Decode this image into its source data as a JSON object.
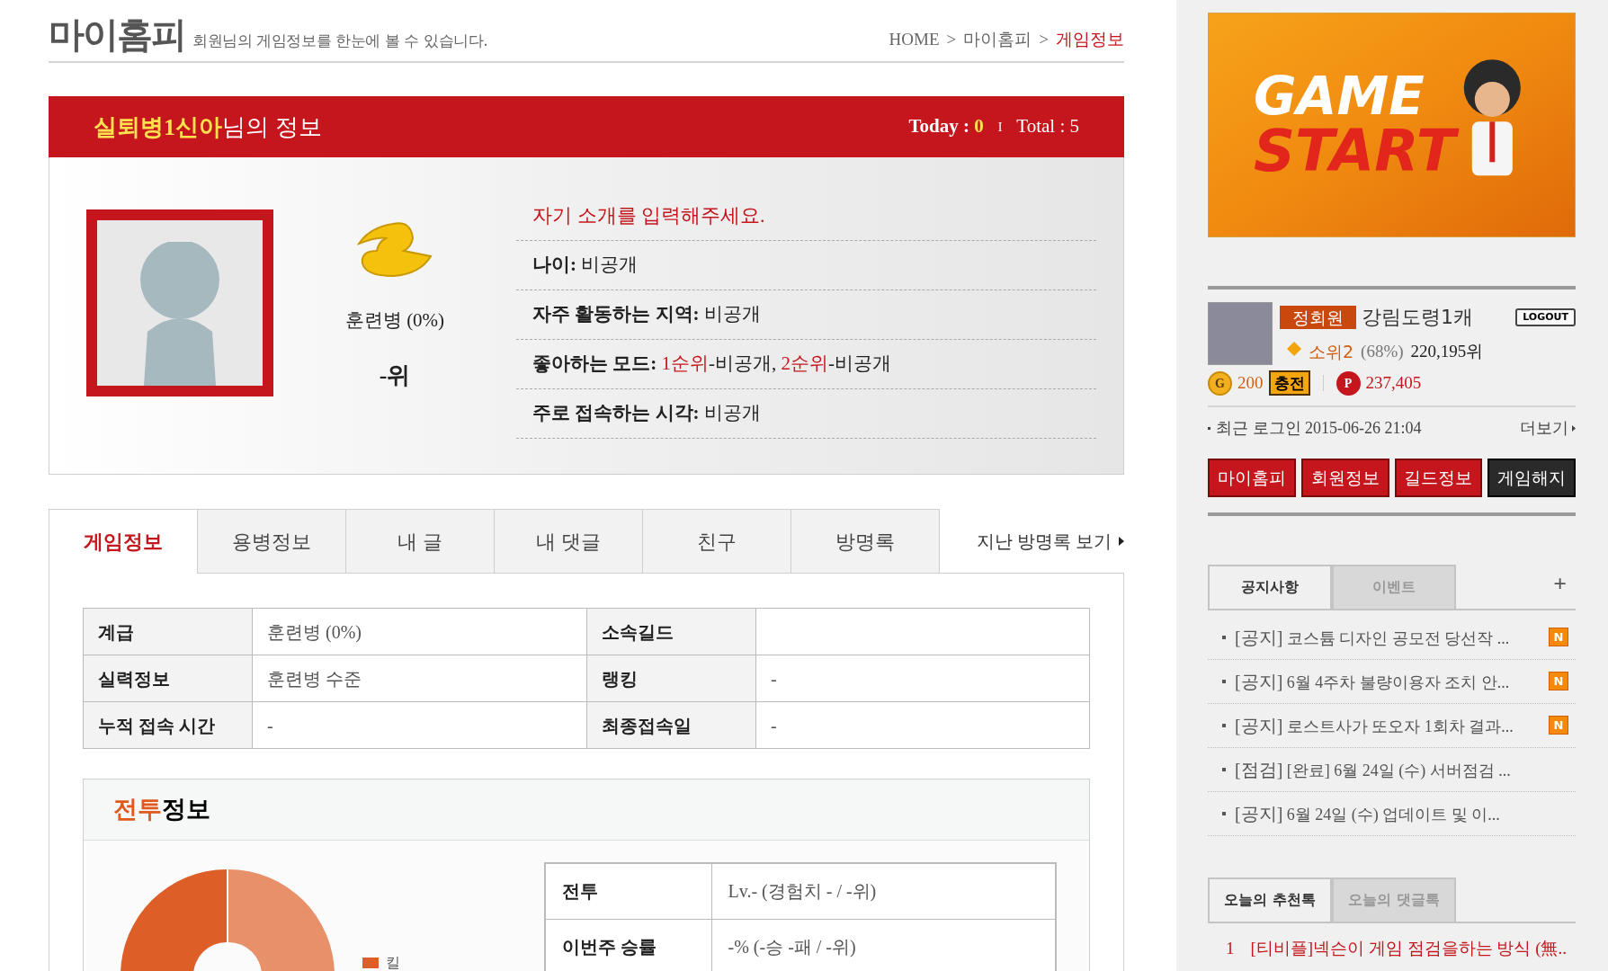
{
  "header": {
    "logo": "마이홈피",
    "subtitle": "회원님의 게임정보를 한눈에 볼 수 있습니다.",
    "breadcrumb": [
      {
        "label": "HOME",
        "selected": false
      },
      {
        "label": "마이홈피",
        "selected": false
      },
      {
        "label": "게임정보",
        "selected": true
      }
    ],
    "separator": ">"
  },
  "profile": {
    "name": "실퇴병1신아",
    "name_suffix": "님의 정보",
    "today_label": "Today : ",
    "today": "0",
    "separator": "I",
    "total": "Total : 5",
    "rank_name": "훈련병 (0%)",
    "rank": "-위",
    "intro": "자기 소개를 입력해주세요.",
    "fields": [
      {
        "label": "나이:",
        "parts": [
          {
            "text": "비공개",
            "highlight": false
          }
        ]
      },
      {
        "label": "자주 활동하는 지역:",
        "parts": [
          {
            "text": "비공개",
            "highlight": false
          }
        ]
      },
      {
        "label": "좋아하는 모드:",
        "parts": [
          {
            "text": "1순위",
            "highlight": true
          },
          {
            "text": "-비공개, ",
            "highlight": false
          },
          {
            "text": "2순위",
            "highlight": true
          },
          {
            "text": "-비공개",
            "highlight": false
          }
        ]
      },
      {
        "label": "주로 접속하는 시각:",
        "parts": [
          {
            "text": "비공개",
            "highlight": false
          }
        ]
      }
    ]
  },
  "tabs": [
    {
      "label": "게임정보",
      "selected": true
    },
    {
      "label": "용병정보",
      "selected": false
    },
    {
      "label": "내 글",
      "selected": false
    },
    {
      "label": "내 댓글",
      "selected": false
    },
    {
      "label": "친구",
      "selected": false
    },
    {
      "label": "방명록",
      "selected": false
    }
  ],
  "guestbook_link": "지난 방명록 보기",
  "info_table": {
    "rows": [
      [
        "계급",
        "훈련병 (0%)",
        "소속길드",
        ""
      ],
      [
        "실력정보",
        "훈련병 수준",
        "랭킹",
        "-"
      ],
      [
        "누적 접속 시간",
        "-",
        "최종접속일",
        "-"
      ]
    ]
  },
  "battle": {
    "title_highlight": "전투",
    "title_rest": "정보",
    "legend": [
      "킬"
    ],
    "rows": [
      {
        "label": "전투",
        "value": "Lv.- (경험치 - / -위)"
      },
      {
        "label": "이번주 승률",
        "value": "-% (-승 -패 / -위)"
      }
    ]
  },
  "sidebar": {
    "banner": {
      "line1": "GAME",
      "line2": "START"
    },
    "user": {
      "grade": "정회원",
      "name": "강림도령1캐",
      "logout": "LOGOUT",
      "rank": "소위2",
      "percent": "(68%)",
      "ranking": "220,195위",
      "coin_symbol": "G",
      "coins": "200",
      "point_symbol": "P",
      "charge": "충전",
      "points": "237,405",
      "last_login_label": "최근 로그인",
      "last_login": "2015-06-26 21:04",
      "more": "더보기"
    },
    "buttons": [
      {
        "label": "마이홈피",
        "kind": "red"
      },
      {
        "label": "회원정보",
        "kind": "red"
      },
      {
        "label": "길드정보",
        "kind": "red"
      },
      {
        "label": "게임해지",
        "kind": "dark"
      }
    ],
    "notice_tabs": [
      {
        "label": "공지사항",
        "selected": true
      },
      {
        "label": "이벤트",
        "selected": false
      }
    ],
    "notice_more": "+",
    "notices": [
      {
        "category": "[공지]",
        "text": "코스튬 디자인 공모전 당선작 ...",
        "badge": "N"
      },
      {
        "category": "[공지]",
        "text": "6월 4주차 불량이용자 조치 안...",
        "badge": "N"
      },
      {
        "category": "[공지]",
        "text": "로스트사가 또오자 1회차 결과...",
        "badge": "N"
      },
      {
        "category": "[점검]",
        "text": "[완료] 6월 24일 (수) 서버점검 ..."
      },
      {
        "category": "[공지]",
        "text": "6월 24일 (수) 업데이트 및 이..."
      }
    ],
    "recommend_tabs": [
      {
        "label": "오늘의 추천톡",
        "selected": true
      },
      {
        "label": "오늘의 댓글톡",
        "selected": false
      }
    ],
    "recommend": [
      {
        "rank": "1",
        "text": "[티비플]넥슨이 게임 점검을하는 방식 (無.."
      }
    ]
  }
}
